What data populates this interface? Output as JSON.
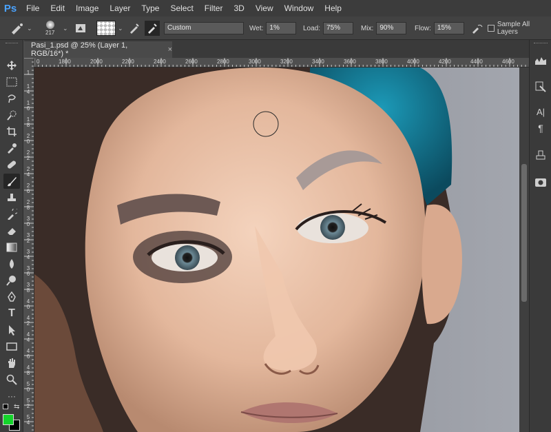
{
  "menubar": {
    "logo": "Ps",
    "items": [
      "File",
      "Edit",
      "Image",
      "Layer",
      "Type",
      "Select",
      "Filter",
      "3D",
      "View",
      "Window",
      "Help"
    ]
  },
  "options": {
    "brush_size": "217",
    "mode_preset": "Custom",
    "wet_label": "Wet:",
    "wet_value": "1%",
    "load_label": "Load:",
    "load_value": "75%",
    "mix_label": "Mix:",
    "mix_value": "90%",
    "flow_label": "Flow:",
    "flow_value": "15%",
    "sample_all_layers": "Sample All Layers"
  },
  "document": {
    "tab_title": "Pasi_1.psd @ 25% (Layer 1, RGB/16*) *",
    "close_glyph": "×"
  },
  "rulers": {
    "top_labels": [
      "0",
      "1800",
      "2000",
      "2200",
      "2400",
      "2600",
      "2800",
      "3000",
      "3200",
      "3400",
      "3600",
      "3800",
      "4000",
      "4200",
      "4400",
      "4600"
    ],
    "left_labels": [
      "1",
      "1\n4",
      "1\n6",
      "1\n8",
      "2\n0",
      "2\n2",
      "2\n4",
      "2\n6",
      "2\n8",
      "3\n0",
      "3\n2",
      "3\n4",
      "3\n6",
      "3\n8",
      "4\n0",
      "4\n2",
      "4\n4",
      "4\n6",
      "4\n8",
      "5\n0",
      "5\n2",
      "5\n4"
    ]
  },
  "colors": {
    "foreground": "#14d42b",
    "background": "#000000",
    "accent": "#4aa3ff"
  },
  "tools": [
    "move-icon",
    "marquee-icon",
    "lasso-icon",
    "quick-select-icon",
    "crop-icon",
    "eyedropper-icon",
    "healing-brush-icon",
    "brush-icon",
    "stamp-icon",
    "history-brush-icon",
    "eraser-icon",
    "gradient-icon",
    "blur-icon",
    "dodge-icon",
    "pen-icon",
    "type-icon",
    "path-select-icon",
    "shape-icon",
    "hand-icon",
    "zoom-icon",
    "more-icon"
  ],
  "tool_glyphs": {
    "type": "T",
    "more": "···"
  },
  "panels": {
    "character_label": "A|",
    "paragraph_glyph": "¶"
  }
}
